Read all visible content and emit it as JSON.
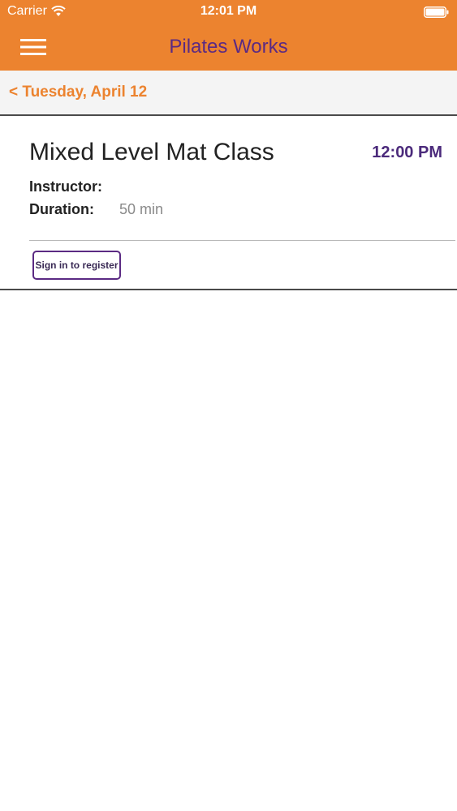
{
  "status_bar": {
    "carrier": "Carrier",
    "time": "12:01 PM",
    "icons": [
      "wifi-icon",
      "battery-icon"
    ]
  },
  "nav": {
    "title": "Pilates Works",
    "menu_icon": "hamburger-menu-icon"
  },
  "date_bar": {
    "back_label": "< Tuesday, April 12"
  },
  "class": {
    "name": "Mixed Level Mat Class",
    "time": "12:00 PM",
    "instructor_label": "Instructor:",
    "instructor_value": "",
    "duration_label": "Duration:",
    "duration_value": "50 min",
    "register_label": "Sign in to register"
  },
  "colors": {
    "brand_orange": "#ec832f",
    "brand_purple": "#5b2a83",
    "text_dark": "#222222",
    "text_muted": "#8a8a8a"
  }
}
